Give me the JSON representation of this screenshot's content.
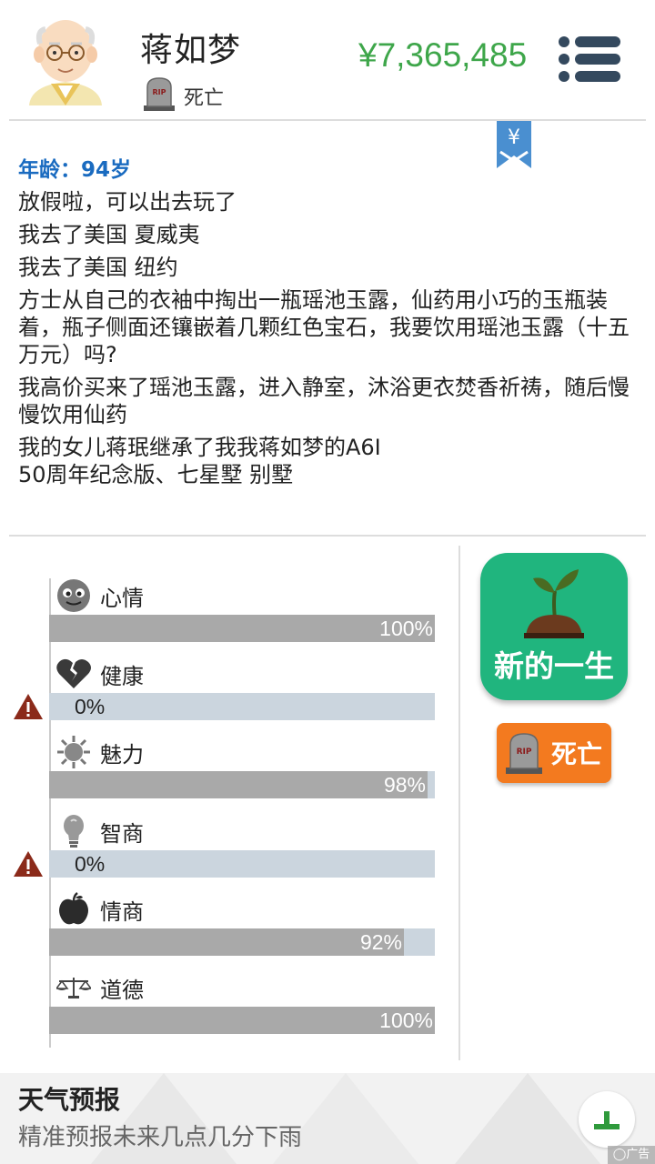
{
  "header": {
    "name": "蒋如梦",
    "status": "死亡",
    "money": "¥7,365,485"
  },
  "bookmark": {
    "symbol": "¥"
  },
  "story": {
    "age": "年龄：94岁",
    "lines": [
      "放假啦，可以出去玩了",
      "我去了美国 夏威夷",
      "我去了美国 纽约",
      "方士从自己的衣袖中掏出一瓶瑶池玉露，仙药用小巧的玉瓶装着，瓶子侧面还镶嵌着几颗红色宝石，我要饮用瑶池玉露（十五万元）吗?",
      "我高价买来了瑶池玉露，进入静室，沐浴更衣焚香祈祷，随后慢慢饮用仙药",
      "我的女儿蒋珉继承了我我蒋如梦的A6I\n50周年纪念版、七星墅 别墅"
    ]
  },
  "stats": [
    {
      "key": "mood",
      "label": "心情",
      "icon": "smiley-face-icon",
      "value": 100,
      "text": "100%",
      "warning": false
    },
    {
      "key": "health",
      "label": "健康",
      "icon": "broken-heart-icon",
      "value": 0,
      "text": "0%",
      "warning": true
    },
    {
      "key": "charm",
      "label": "魅力",
      "icon": "sun-icon",
      "value": 98,
      "text": "98%",
      "warning": false
    },
    {
      "key": "iq",
      "label": "智商",
      "icon": "lightbulb-icon",
      "value": 0,
      "text": "0%",
      "warning": true
    },
    {
      "key": "eq",
      "label": "情商",
      "icon": "apple-icon",
      "value": 92,
      "text": "92%",
      "warning": false
    },
    {
      "key": "morality",
      "label": "道德",
      "icon": "balance-scale-icon",
      "value": 100,
      "text": "100%",
      "warning": false
    }
  ],
  "buttons": {
    "new_life": "新的一生",
    "death": "死亡"
  },
  "ad": {
    "title": "天气预报",
    "subtitle": "精准预报未来几点几分下雨",
    "tag": "广告"
  },
  "colors": {
    "money": "#3ea64a",
    "age": "#1a6bc0",
    "new_life_button": "#20b57e",
    "death_button": "#f37a1f",
    "bar_track": "#cbd5de",
    "bar_fill": "#a9a9a9"
  }
}
